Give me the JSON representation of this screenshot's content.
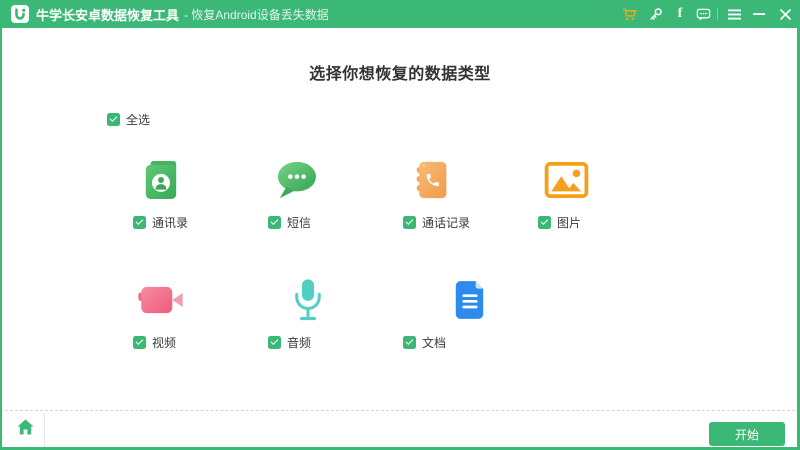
{
  "titlebar": {
    "title": "牛学长安卓数据恢复工具",
    "subtitle": "- 恢复Android设备丢失数据",
    "facebook_glyph": "f",
    "icons": [
      "cart-icon",
      "key-icon",
      "facebook-icon",
      "feedback-icon",
      "menu-icon",
      "minimize-icon",
      "close-icon"
    ]
  },
  "main": {
    "heading": "选择你想恢复的数据类型",
    "select_all_label": "全选",
    "select_all_checked": true,
    "categories": [
      {
        "label": "通讯录",
        "icon": "contacts-icon",
        "checked": true
      },
      {
        "label": "短信",
        "icon": "sms-icon",
        "checked": true
      },
      {
        "label": "通话记录",
        "icon": "call-history-icon",
        "checked": true
      },
      {
        "label": "图片",
        "icon": "pictures-icon",
        "checked": true
      },
      {
        "label": "视频",
        "icon": "video-icon",
        "checked": true
      },
      {
        "label": "音频",
        "icon": "audio-icon",
        "checked": true
      },
      {
        "label": "文档",
        "icon": "documents-icon",
        "checked": true
      }
    ]
  },
  "footer": {
    "start_button": "开始",
    "home_icon": "home-icon"
  },
  "colors": {
    "brand_green": "#3cb876",
    "cart_orange": "#f0a91c",
    "contacts_green": "#46b35f",
    "sms_green": "#4dbd60",
    "call_orange": "#f3a55c",
    "pictures_orange": "#f5a01a",
    "video_pink": "#f1687f",
    "audio_teal": "#52cfc5",
    "document_blue": "#2e8bee",
    "heading_text": "#333333",
    "label_text": "#3a3a3a"
  }
}
